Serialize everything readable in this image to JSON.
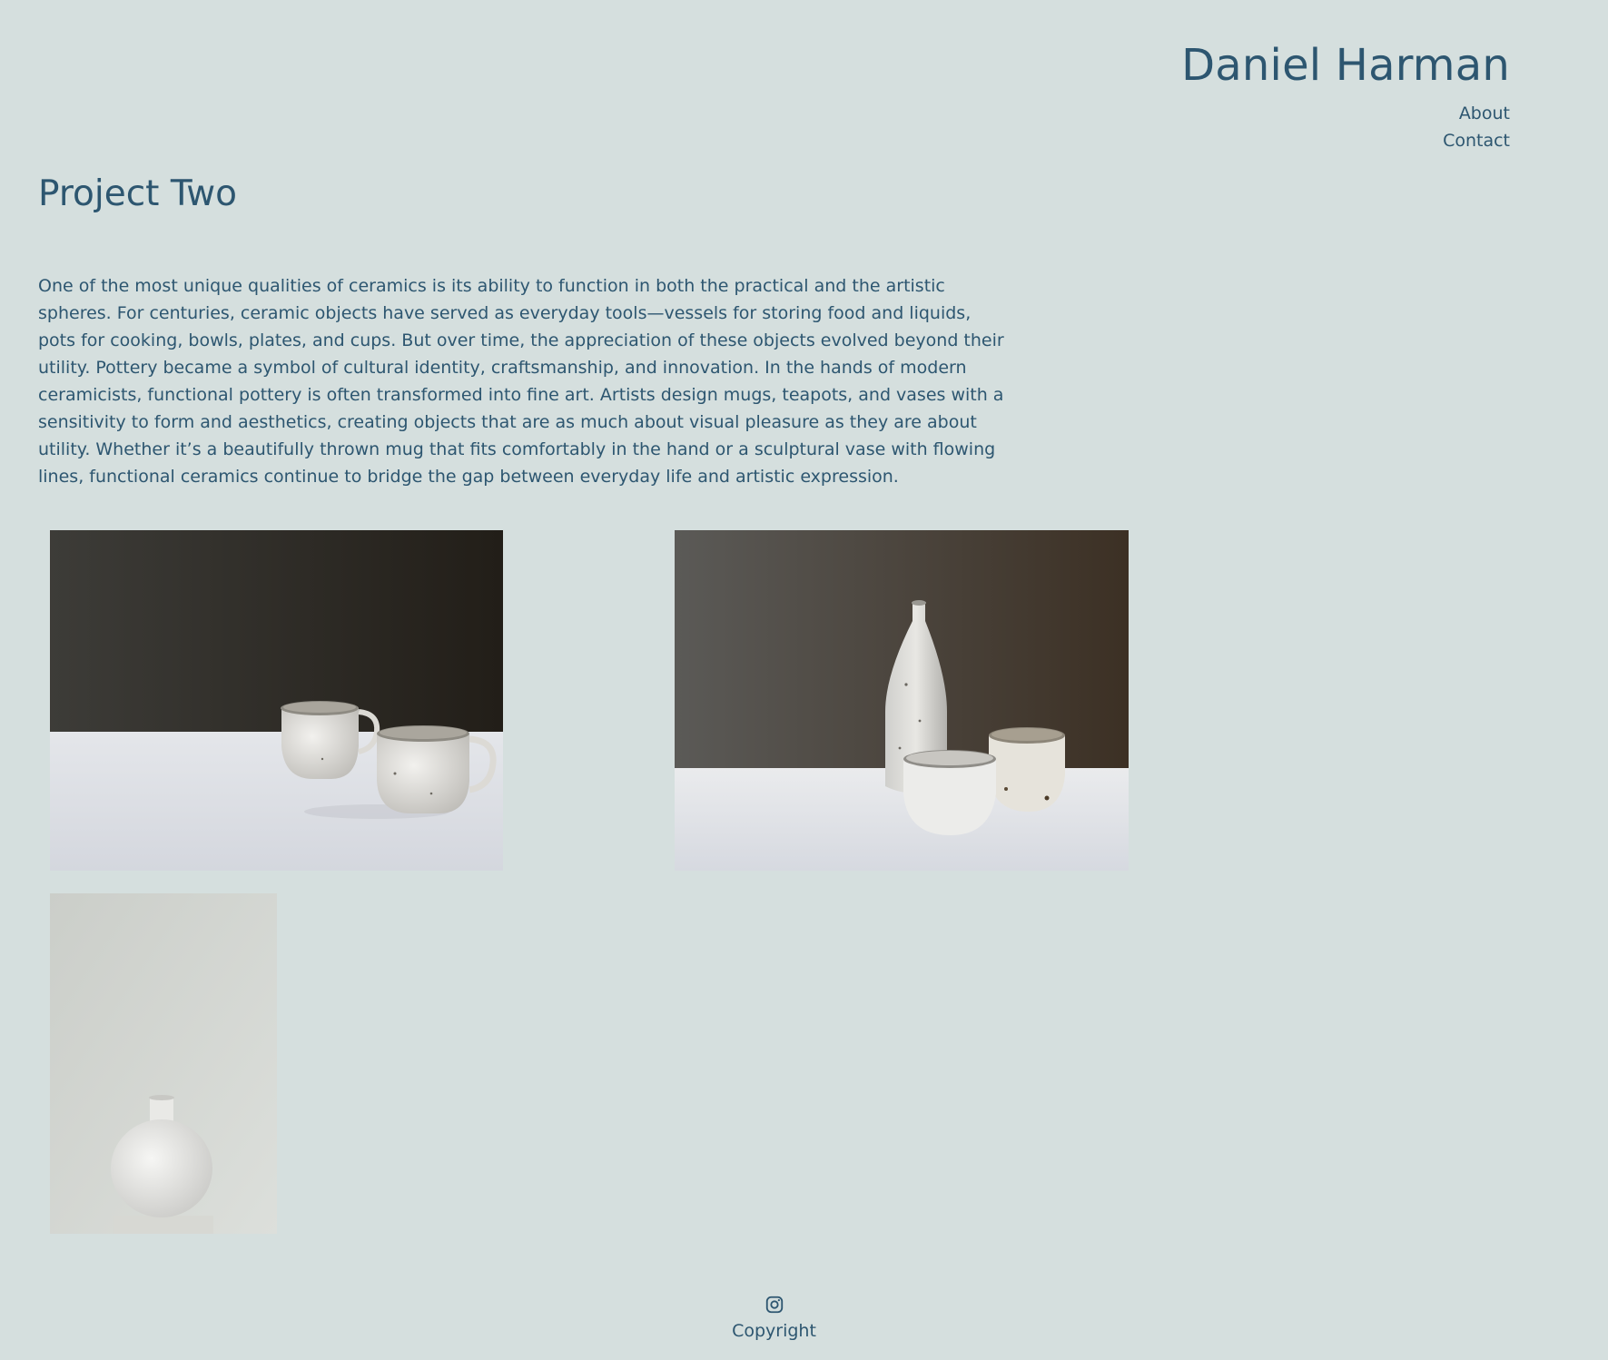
{
  "header": {
    "site_title": "Daniel Harman",
    "nav": [
      {
        "label": "About"
      },
      {
        "label": "Contact"
      }
    ]
  },
  "main": {
    "title": "Project Two",
    "body": "One of the most unique qualities of ceramics is its ability to function in both the practical and the artistic spheres. For centuries, ceramic objects have served as everyday tools—vessels for storing food and liquids, pots for cooking, bowls, plates, and cups. But over time, the appreciation of these objects evolved beyond their utility. Pottery became a symbol of cultural identity, craftsmanship, and innovation. In the hands of modern ceramicists, functional pottery is often transformed into fine art. Artists design mugs, teapots, and vases with a sensitivity to form and aesthetics, creating objects that are as much about visual pleasure as they are about utility. Whether it’s a beautifully thrown mug that fits comfortably in the hand or a sculptural vase with flowing lines, functional ceramics continue to bridge the gap between everyday life and artistic expression."
  },
  "gallery": [
    {
      "subject": "two speckled white ceramic mugs on white table, dark background"
    },
    {
      "subject": "speckled bottle vase with two cups, dark background"
    },
    {
      "subject": "white moon flask vase on pale background"
    }
  ],
  "footer": {
    "icon": "instagram-icon",
    "copyright": "Copyright"
  },
  "colors": {
    "background": "#d5dfde",
    "text": "#2d5670"
  }
}
